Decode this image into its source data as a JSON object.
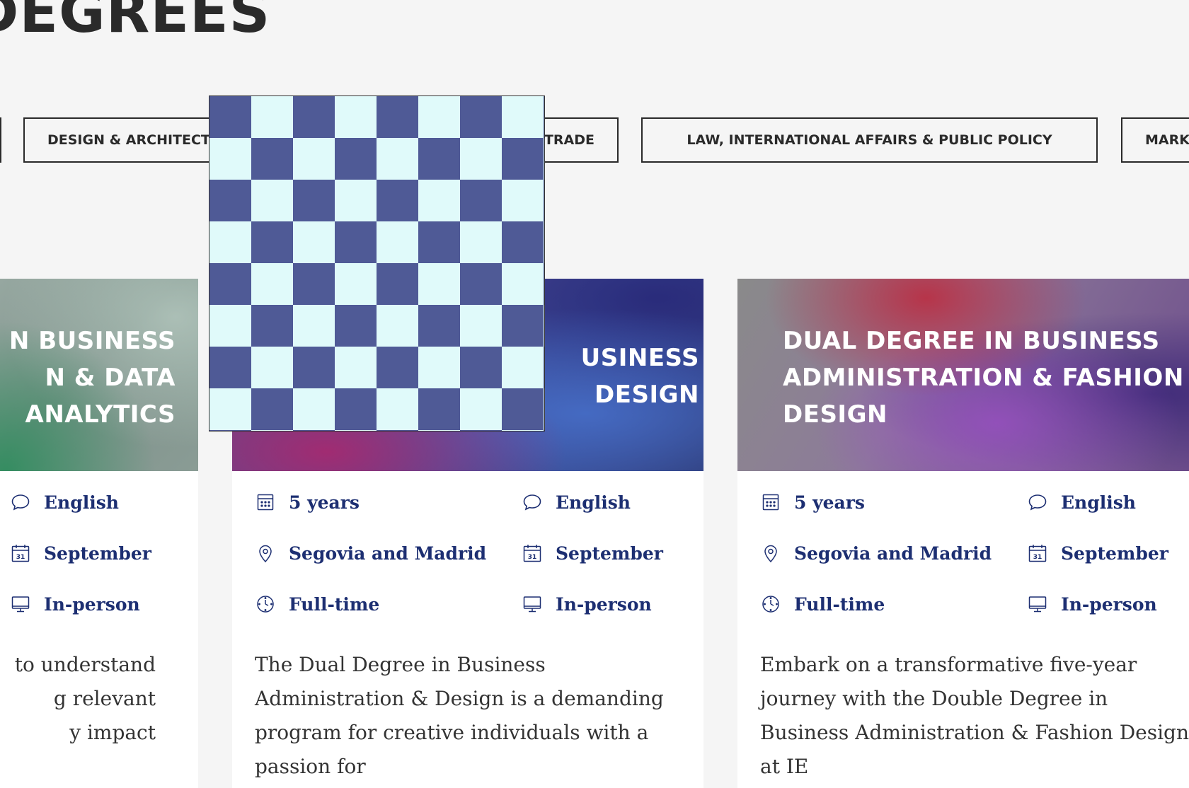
{
  "page": {
    "heading": "DEGREES"
  },
  "filters": [
    {
      "label": ""
    },
    {
      "label": "DESIGN & ARCHITECTURE"
    },
    {
      "label": "TRADE"
    },
    {
      "label": "LAW, INTERNATIONAL AFFAIRS & PUBLIC POLICY"
    },
    {
      "label": "MARKETING"
    }
  ],
  "cards": [
    {
      "title": "BUSINESS & DATA ANALYTICS",
      "title_visible": "N BUSINESS\nN & DATA\nANALYTICS",
      "meta": {
        "language": "English",
        "intake": "September",
        "mode": "In-person"
      },
      "description": "to understand\ng relevant\ny impact"
    },
    {
      "title_visible": "USINESS\nDESIGN",
      "meta": {
        "duration": "5 years",
        "language": "English",
        "location": "Segovia and Madrid",
        "intake": "September",
        "format": "Full-time",
        "mode": "In-person"
      },
      "description": "The Dual Degree in Business Administration & Design is a demanding program for creative individuals with a passion for"
    },
    {
      "title_visible": "DUAL DEGREE IN BUSINESS ADMINISTRATION & FASHION DESIGN",
      "meta": {
        "duration": "5 years",
        "language": "English",
        "location": "Segovia and Madrid",
        "intake": "September",
        "format": "Full-time",
        "mode": "In-person"
      },
      "description": "Embark on a transformative five-year journey with the Double Degree in Business Administration & Fashion Design at IE"
    }
  ],
  "colors": {
    "background": "#f5f5f5",
    "meta_text": "#1d2f72",
    "heading": "#2a2a2a",
    "checker_dark": "#4f5a96",
    "checker_light": "#e0fafa"
  },
  "icons": [
    "chat-bubble-icon",
    "calendar-icon",
    "monitor-icon",
    "calculator-grid-icon",
    "location-pin-icon",
    "clock-icon"
  ]
}
